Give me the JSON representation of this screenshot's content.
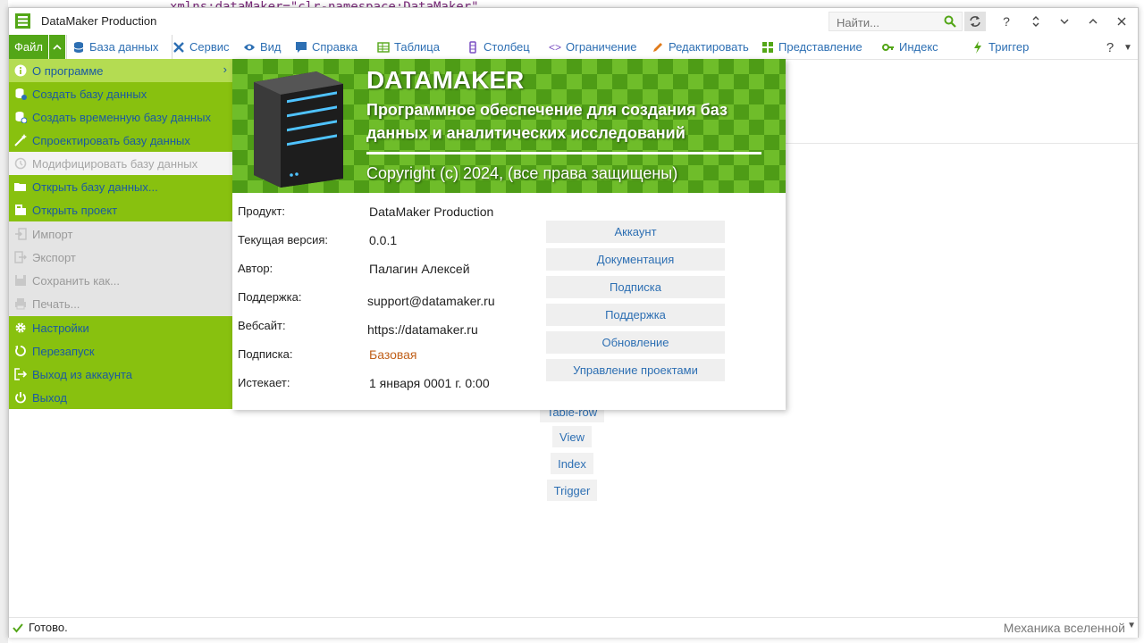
{
  "window": {
    "title": "DataMaker Production"
  },
  "background": {
    "code_text": "xmlns:dataMaker=\"clr-namespace:DataMaker\""
  },
  "search": {
    "placeholder": "Найти..."
  },
  "titlebar_buttons": [
    "refresh",
    "help",
    "expand",
    "collapse",
    "up",
    "close"
  ],
  "ribbon": {
    "file_label": "Файл",
    "tabs": [
      {
        "label": "База данных",
        "icon": "database-icon"
      },
      {
        "label": "Сервис",
        "icon": "tools-icon"
      },
      {
        "label": "Вид",
        "icon": "eye-icon"
      },
      {
        "label": "Справка",
        "icon": "chat-icon"
      },
      {
        "label": "Таблица",
        "icon": "table-icon"
      },
      {
        "label": "Столбец",
        "icon": "column-icon"
      },
      {
        "label": "Ограничение",
        "icon": "code-icon"
      },
      {
        "label": "Редактировать",
        "icon": "pencil-icon"
      },
      {
        "label": "Представление",
        "icon": "grid-icon"
      },
      {
        "label": "Индекс",
        "icon": "key-icon"
      },
      {
        "label": "Триггер",
        "icon": "bolt-icon"
      }
    ]
  },
  "file_menu": {
    "items": [
      {
        "label": "О программе",
        "icon": "info-icon",
        "state": "highlight"
      },
      {
        "label": "Создать базу данных",
        "icon": "new-db-icon",
        "state": "enabled"
      },
      {
        "label": "Создать временную базу данных",
        "icon": "temp-db-icon",
        "state": "enabled"
      },
      {
        "label": "Спроектировать базу данных",
        "icon": "wand-icon",
        "state": "enabled"
      },
      {
        "label": "Модифицировать базу данных",
        "icon": "modify-icon",
        "state": "disabled-light"
      },
      {
        "label": "Открыть базу данных...",
        "icon": "folder-icon",
        "state": "enabled"
      },
      {
        "label": "Открыть проект",
        "icon": "project-icon",
        "state": "enabled"
      },
      {
        "label": "Импорт",
        "icon": "import-icon",
        "state": "disabled"
      },
      {
        "label": "Экспорт",
        "icon": "export-icon",
        "state": "disabled"
      },
      {
        "label": "Сохранить как...",
        "icon": "save-icon",
        "state": "disabled"
      },
      {
        "label": "Печать...",
        "icon": "print-icon",
        "state": "disabled"
      },
      {
        "label": "Настройки",
        "icon": "gear-icon",
        "state": "enabled"
      },
      {
        "label": "Перезапуск",
        "icon": "restart-icon",
        "state": "enabled"
      },
      {
        "label": "Выход из аккаунта",
        "icon": "logout-icon",
        "state": "enabled"
      },
      {
        "label": "Выход",
        "icon": "power-icon",
        "state": "enabled"
      }
    ]
  },
  "about": {
    "banner_title": "DATAMAKER",
    "banner_subtitle": "Программное обеспечение для создания баз данных и аналитических исследований",
    "banner_copyright": "Copyright (c) 2024, (все права защищены)",
    "fields": [
      {
        "label": "Продукт:",
        "value": "DataMaker Production"
      },
      {
        "label": "Текущая версия:",
        "value": "0.0.1"
      },
      {
        "label": "Автор:",
        "value": "Палагин Алексей"
      },
      {
        "label": "Поддержка:",
        "value": "support@datamaker.ru"
      },
      {
        "label": "Вебсайт:",
        "value": "https://datamaker.ru"
      },
      {
        "label": "Подписка:",
        "value": "Базовая"
      },
      {
        "label": "Истекает:",
        "value": "1 января 0001 г. 0:00"
      }
    ],
    "buttons": [
      "Аккаунт",
      "Документация",
      "Подписка",
      "Поддержка",
      "Обновление",
      "Управление проектами"
    ]
  },
  "object_buttons": [
    "Table-row",
    "View",
    "Index",
    "Trigger"
  ],
  "status": {
    "text": "Готово.",
    "right_text": "Механика вселенной"
  },
  "colors": {
    "accent_green": "#88c10f",
    "dark_green": "#53a617",
    "link_blue": "#2d6fb3"
  }
}
